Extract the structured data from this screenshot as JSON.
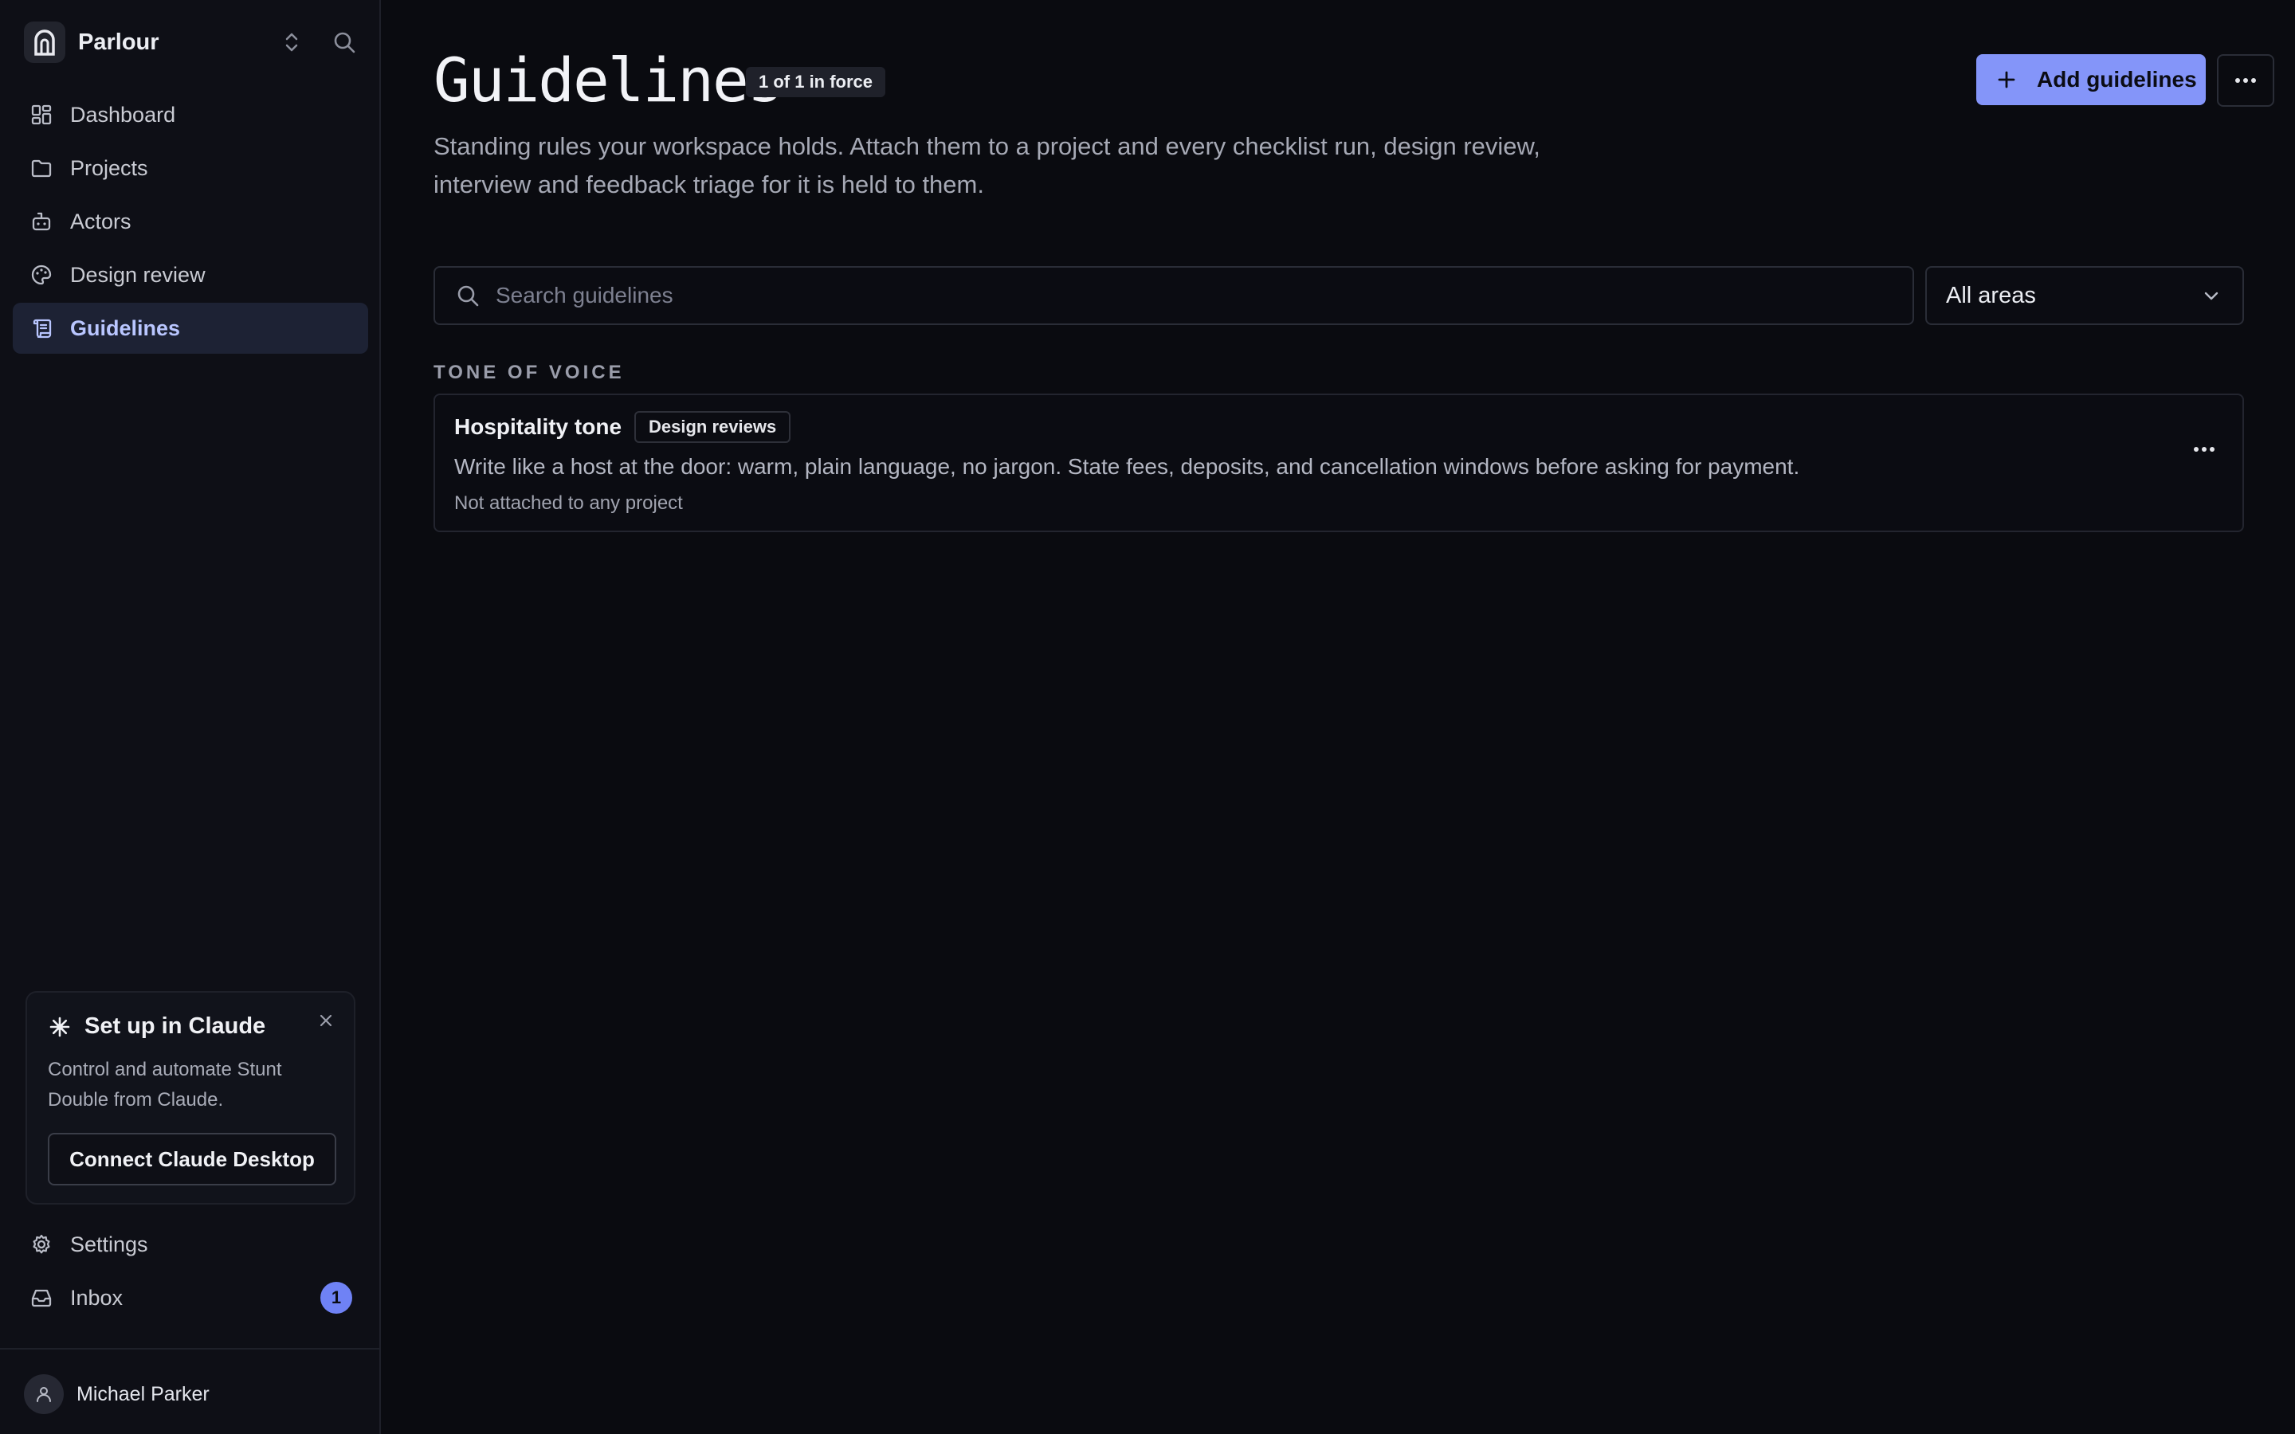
{
  "workspace": {
    "name": "Parlour"
  },
  "nav": {
    "items": [
      {
        "label": "Dashboard"
      },
      {
        "label": "Projects"
      },
      {
        "label": "Actors"
      },
      {
        "label": "Design review"
      },
      {
        "label": "Guidelines",
        "active": true
      }
    ]
  },
  "promo": {
    "title": "Set up in Claude",
    "text": "Control and automate Stunt Double from Claude.",
    "button": "Connect Claude Desktop"
  },
  "bottom_nav": {
    "settings": "Settings",
    "inbox": "Inbox",
    "inbox_count": "1"
  },
  "user": {
    "name": "Michael Parker"
  },
  "page": {
    "title": "Guidelines",
    "count_badge": "1 of 1 in force",
    "description": "Standing rules your workspace holds. Attach them to a project and every checklist run, design review, interview and feedback triage for it is held to them.",
    "add_button": "Add guidelines"
  },
  "filters": {
    "search_placeholder": "Search guidelines",
    "area_selected": "All areas"
  },
  "sections": [
    {
      "label": "TONE OF VOICE",
      "guidelines": [
        {
          "title": "Hospitality tone",
          "tag": "Design reviews",
          "description": "Write like a host at the door: warm, plain language, no jargon. State fees, deposits, and cancellation windows before asking for payment.",
          "meta": "Not attached to any project"
        }
      ]
    }
  ],
  "colors": {
    "accent": "#8495f9",
    "active_nav_bg": "#1d2234",
    "badge": "#6f82f5",
    "background": "#0a0b10"
  }
}
